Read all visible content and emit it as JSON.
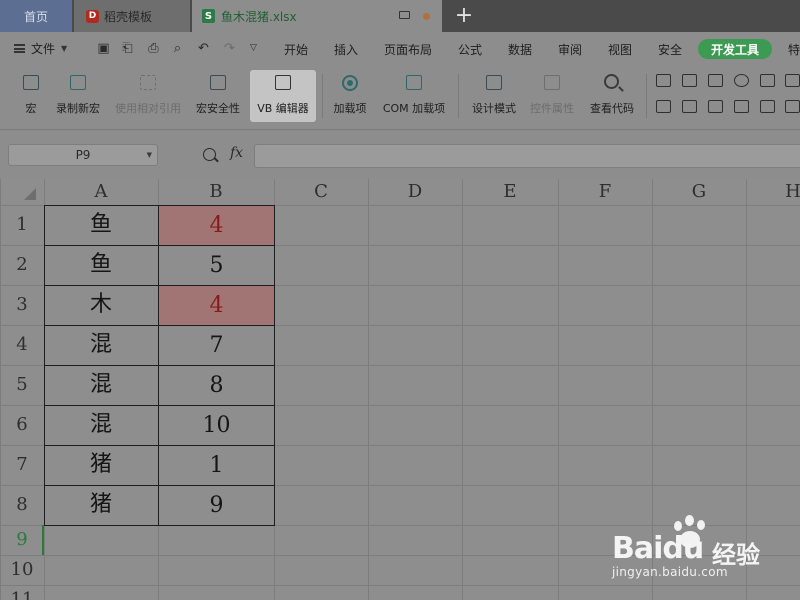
{
  "tabs": {
    "home_label": "首页",
    "template_label": "稻壳模板",
    "template_icon_letter": "D",
    "active_file_label": "鱼木混猪.xlsx",
    "active_file_icon_letter": "S",
    "add_symbol": "+"
  },
  "menubar": {
    "file_label": "文件",
    "items": [
      "开始",
      "插入",
      "页面布局",
      "公式",
      "数据",
      "审阅",
      "视图",
      "安全"
    ],
    "active_item": "开发工具",
    "overflow_item": "特"
  },
  "ribbon": {
    "buttons": [
      {
        "label": "宏",
        "icon": "macro-icon"
      },
      {
        "label": "录制新宏",
        "icon": "record-macro-icon"
      },
      {
        "label": "使用相对引用",
        "icon": "relative-reference-icon"
      },
      {
        "label": "宏安全性",
        "icon": "macro-security-icon"
      },
      {
        "label": "VB 编辑器",
        "icon": "vb-editor-icon"
      },
      {
        "label": "加载项",
        "icon": "addins-icon"
      },
      {
        "label": "COM 加载项",
        "icon": "com-addins-icon"
      },
      {
        "label": "设计模式",
        "icon": "design-mode-icon"
      },
      {
        "label": "控件属性",
        "icon": "control-properties-icon"
      },
      {
        "label": "查看代码",
        "icon": "view-code-icon"
      }
    ]
  },
  "formula": {
    "name_box_value": "P9",
    "fx_label": "fx",
    "formula_value": ""
  },
  "sheet": {
    "columns": [
      "A",
      "B",
      "C",
      "D",
      "E",
      "F",
      "G",
      "H"
    ],
    "rows": [
      "1",
      "2",
      "3",
      "4",
      "5",
      "6",
      "7",
      "8",
      "9",
      "10",
      "11"
    ],
    "active_row": "9",
    "data": [
      {
        "a": "鱼",
        "b": "4",
        "highlight": true
      },
      {
        "a": "鱼",
        "b": "5",
        "highlight": false
      },
      {
        "a": "木",
        "b": "4",
        "highlight": true
      },
      {
        "a": "混",
        "b": "7",
        "highlight": false
      },
      {
        "a": "混",
        "b": "8",
        "highlight": false
      },
      {
        "a": "混",
        "b": "10",
        "highlight": false
      },
      {
        "a": "猪",
        "b": "1",
        "highlight": false
      },
      {
        "a": "猪",
        "b": "9",
        "highlight": false
      }
    ],
    "highlight_fill": "#a27575",
    "highlight_text": "#8a1a1a"
  },
  "colors": {
    "dev_tab_accent": "#3c9a52",
    "home_tab": "#5c6f92",
    "active_row_header": "#2a7a3a"
  },
  "watermark": {
    "brand": "Baidu",
    "product": "经验",
    "url": "jingyan.baidu.com"
  }
}
